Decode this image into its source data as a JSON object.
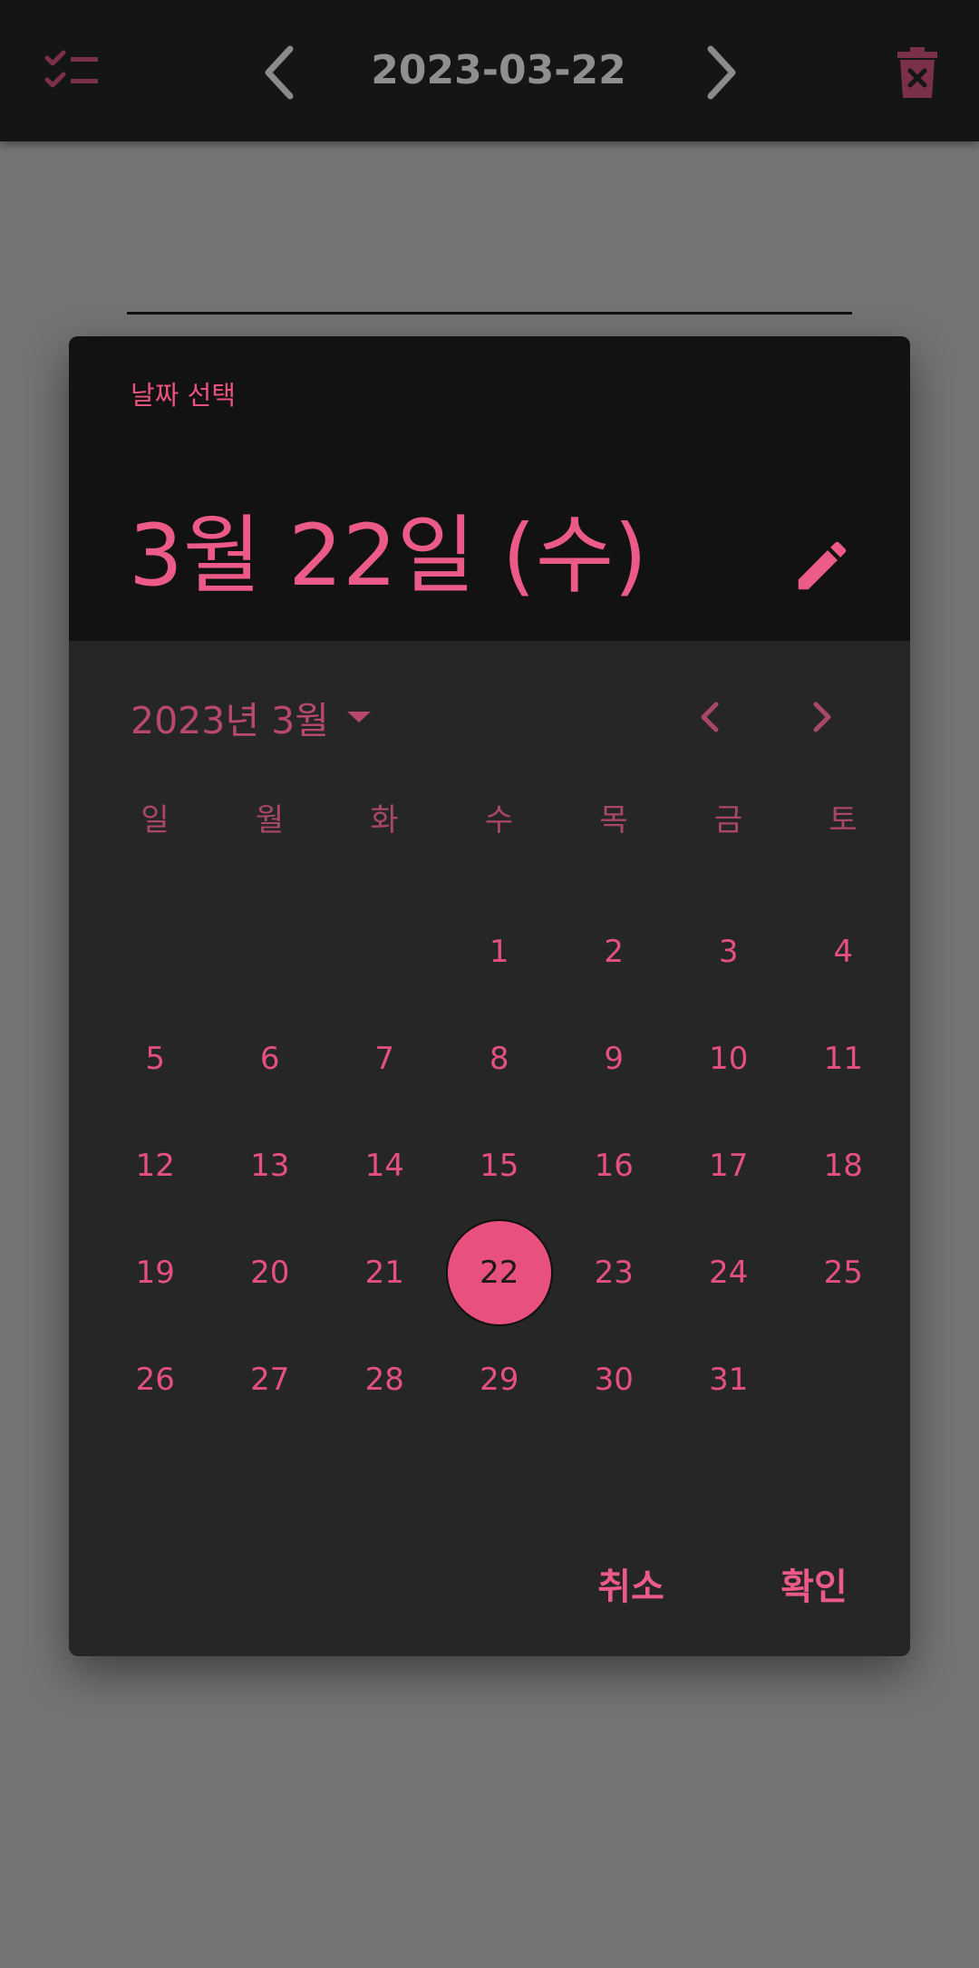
{
  "topbar": {
    "date": "2023-03-22",
    "icons": {
      "checklist": "checklist-icon",
      "prev": "chevron-left-icon",
      "next": "chevron-right-icon",
      "delete": "trash-icon"
    }
  },
  "dialog": {
    "label": "날짜 선택",
    "selected_date_text": "3월 22일 (수)",
    "month_label": "2023년 3월",
    "weekdays": [
      "일",
      "월",
      "화",
      "수",
      "목",
      "금",
      "토"
    ],
    "first_weekday_index": 3,
    "days_in_month": 31,
    "selected_day": 22,
    "cancel_label": "취소",
    "ok_label": "확인"
  },
  "colors": {
    "accent": "#e8507e",
    "header_bg": "#121212",
    "dialog_bg": "#262626",
    "appbar_bg": "#141516",
    "scrim": "#747474"
  }
}
